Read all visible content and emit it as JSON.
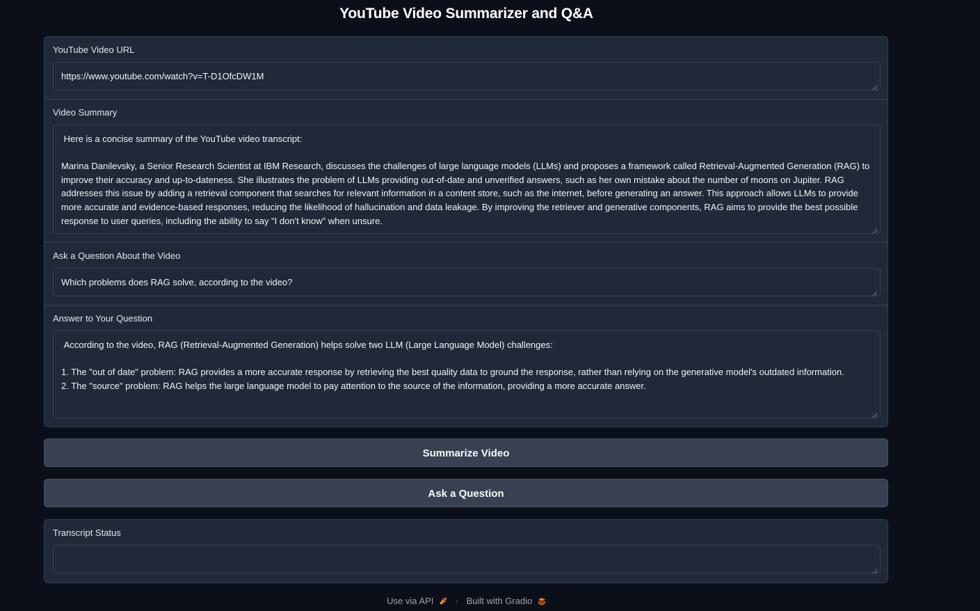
{
  "header": {
    "title": "YouTube Video Summarizer and Q&A"
  },
  "fields": {
    "url": {
      "label": "YouTube Video URL",
      "value": "https://www.youtube.com/watch?v=T-D1OfcDW1M"
    },
    "summary": {
      "label": "Video Summary",
      "value": " Here is a concise summary of the YouTube video transcript:\n\nMarina Danilevsky, a Senior Research Scientist at IBM Research, discusses the challenges of large language models (LLMs) and proposes a framework called Retrieval-Augmented Generation (RAG) to improve their accuracy and up-to-dateness. She illustrates the problem of LLMs providing out-of-date and unverified answers, such as her own mistake about the number of moons on Jupiter. RAG addresses this issue by adding a retrieval component that searches for relevant information in a content store, such as the internet, before generating an answer. This approach allows LLMs to provide more accurate and evidence-based responses, reducing the likelihood of hallucination and data leakage. By improving the retriever and generative components, RAG aims to provide the best possible response to user queries, including the ability to say \"I don't know\" when unsure."
    },
    "question": {
      "label": "Ask a Question About the Video",
      "value": "Which problems does RAG solve, according to the video?"
    },
    "answer": {
      "label": "Answer to Your Question",
      "value": " According to the video, RAG (Retrieval-Augmented Generation) helps solve two LLM (Large Language Model) challenges:\n\n1. The \"out of date\" problem: RAG provides a more accurate response by retrieving the best quality data to ground the response, rather than relying on the generative model's outdated information.\n2. The \"source\" problem: RAG helps the large language model to pay attention to the source of the information, providing a more accurate answer."
    },
    "status": {
      "label": "Transcript Status",
      "value": ""
    }
  },
  "buttons": {
    "summarize": "Summarize Video",
    "ask": "Ask a Question"
  },
  "footer": {
    "api_link": "Use via API",
    "separator": "·",
    "built_with": "Built with Gradio"
  },
  "colors": {
    "background": "#0b0f19",
    "panel": "#1f2937",
    "border": "#374151",
    "button": "#374151",
    "text": "#e5e7eb"
  },
  "icons": {
    "api": "rocket-icon",
    "gradio": "gradio-logo-icon"
  }
}
